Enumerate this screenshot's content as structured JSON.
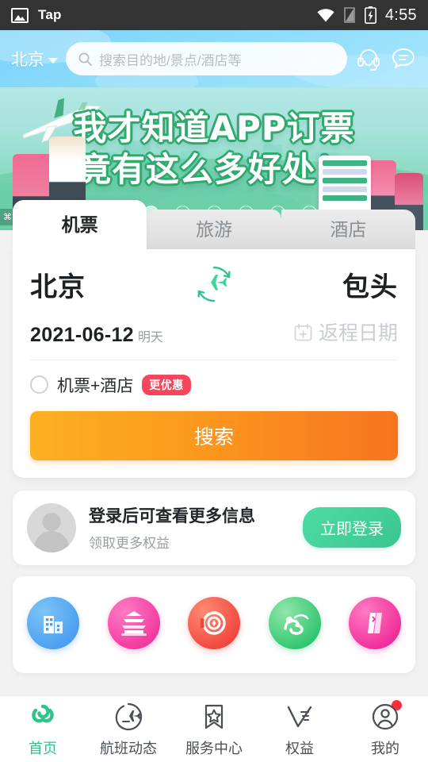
{
  "statusbar": {
    "app_name": "Tap",
    "time": "4:55",
    "icons": [
      "image-icon",
      "wifi-icon",
      "signal-icon",
      "battery-charging-icon"
    ]
  },
  "header": {
    "city": "北京",
    "search_placeholder": "搜索目的地/景点/酒店等",
    "service_icon": "headset-icon",
    "message_icon": "message-icon"
  },
  "banner": {
    "line1": "我才知道APP订票",
    "line2": "竟有这么多好处！",
    "ad_label": "广告",
    "dots_total": 7,
    "dots_active_index": 1
  },
  "booking": {
    "tabs": [
      {
        "label": "机票",
        "active": true
      },
      {
        "label": "旅游",
        "active": false
      },
      {
        "label": "酒店",
        "active": false
      }
    ],
    "from_city": "北京",
    "to_city": "包头",
    "swap_icon": "plane-swap-icon",
    "depart_date": "2021-06-12",
    "depart_date_sub": "明天",
    "return_placeholder": "返程日期",
    "calendar_icon": "calendar-icon",
    "option_label": "机票+酒店",
    "option_badge": "更优惠",
    "option_checked": false,
    "search_button": "搜索"
  },
  "login": {
    "title": "登录后可查看更多信息",
    "subtitle": "领取更多权益",
    "button": "立即登录",
    "avatar_icon": "avatar-icon"
  },
  "quick_entries": [
    {
      "name": "hotel-icon",
      "color": "#4b9ef0"
    },
    {
      "name": "temple-icon",
      "color": "#f3389f"
    },
    {
      "name": "coupon-icon",
      "color": "#f0443c"
    },
    {
      "name": "tour-icon",
      "color": "#2ec46f"
    },
    {
      "name": "ticket-icon",
      "color": "#ef2a98"
    }
  ],
  "bottom_nav": [
    {
      "label": "首页",
      "icon": "home-spiral-icon",
      "active": true,
      "badge": false
    },
    {
      "label": "航班动态",
      "icon": "flight-status-icon",
      "active": false,
      "badge": false
    },
    {
      "label": "服务中心",
      "icon": "service-bookmark-icon",
      "active": false,
      "badge": false
    },
    {
      "label": "权益",
      "icon": "benefits-icon",
      "active": false,
      "badge": false
    },
    {
      "label": "我的",
      "icon": "profile-icon",
      "active": false,
      "badge": true
    }
  ],
  "colors": {
    "accent_green": "#2ec48c",
    "header_blue": "#8ddcfb",
    "button_orange": "#f7741f",
    "badge_red": "#f6465d",
    "status_dark": "#333333"
  }
}
